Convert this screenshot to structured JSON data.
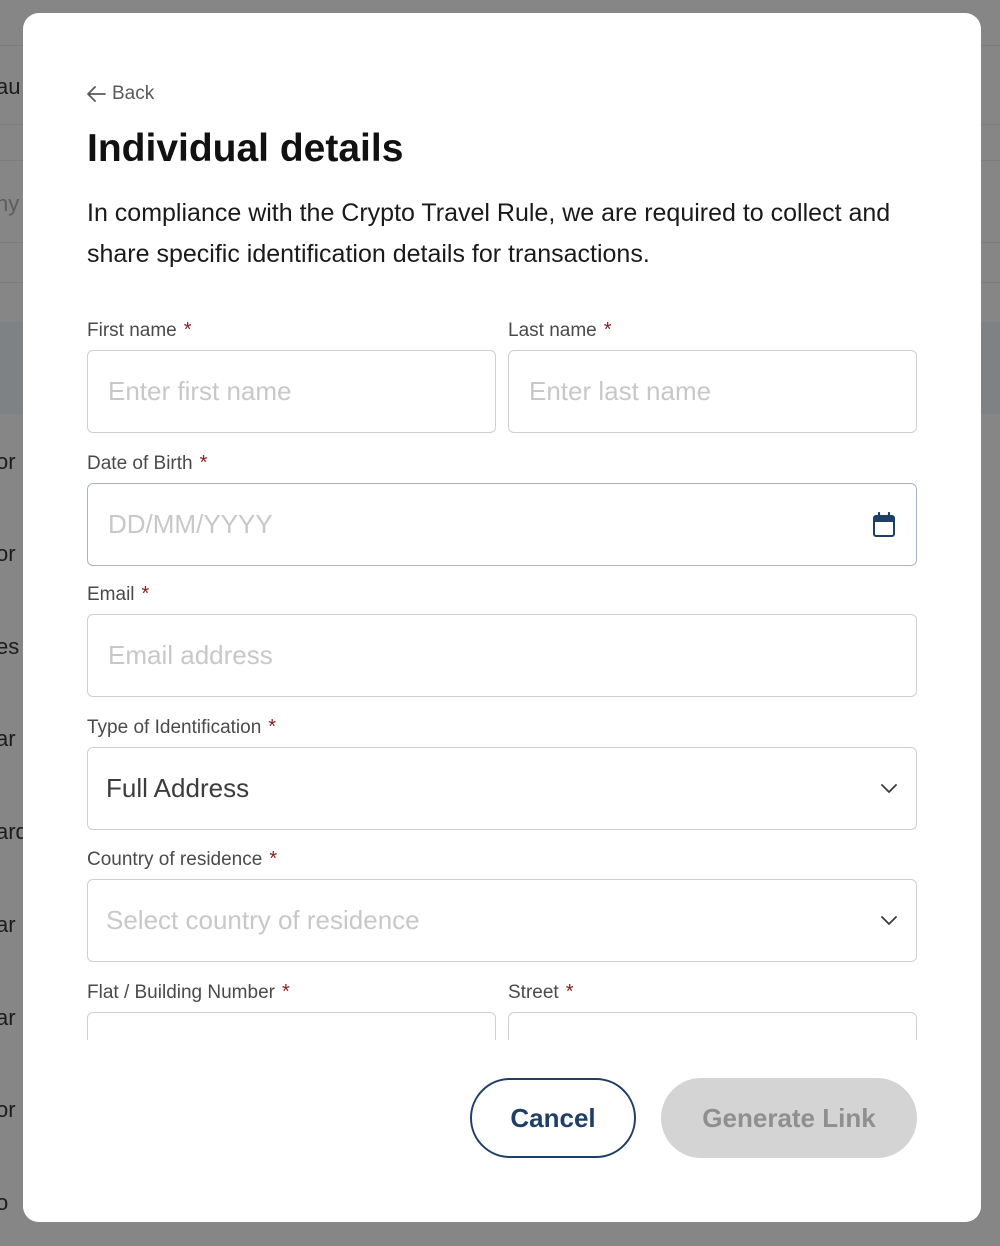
{
  "background": {
    "row_fragments": [
      "au",
      "ny",
      "or",
      "or",
      "es",
      "ar",
      "ard",
      "ar",
      "ar",
      "or",
      "o"
    ]
  },
  "modal": {
    "back_label": "Back",
    "title": "Individual details",
    "description": "In compliance with the Crypto Travel Rule, we are required to collect and share specific identification details for transactions.",
    "required_marker": "*",
    "fields": {
      "first_name": {
        "label": "First name",
        "placeholder": "Enter first name",
        "value": ""
      },
      "last_name": {
        "label": "Last name",
        "placeholder": "Enter last name",
        "value": ""
      },
      "dob": {
        "label": "Date of Birth",
        "placeholder": "DD/MM/YYYY",
        "value": "",
        "icon": "calendar-icon"
      },
      "email": {
        "label": "Email",
        "placeholder": "Email address",
        "value": ""
      },
      "id_type": {
        "label": "Type of Identification",
        "value": "Full Address",
        "icon": "chevron-down-icon"
      },
      "country": {
        "label": "Country of residence",
        "placeholder": "Select country of residence",
        "icon": "chevron-down-icon"
      },
      "flat": {
        "label": "Flat / Building Number",
        "value": ""
      },
      "street": {
        "label": "Street",
        "value": ""
      }
    },
    "buttons": {
      "cancel": "Cancel",
      "generate": "Generate Link"
    }
  },
  "colors": {
    "required": "#8a1c1c",
    "primary": "#1f3f66",
    "disabled_bg": "#d4d4d4",
    "disabled_text": "#8f8f8f"
  }
}
